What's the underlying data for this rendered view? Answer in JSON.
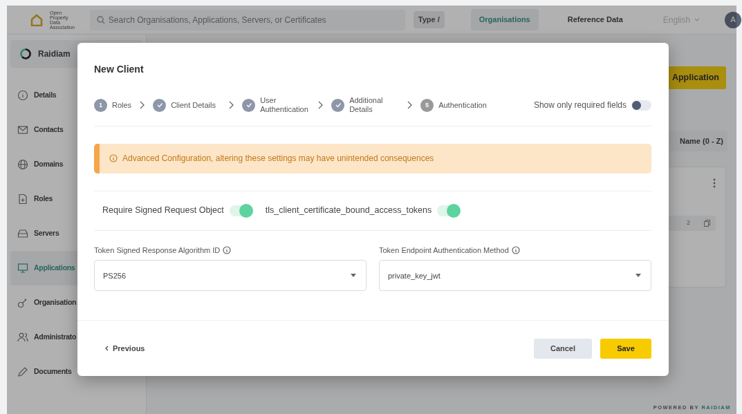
{
  "header": {
    "logo_lines": [
      "Open Property",
      "Data Association"
    ],
    "search": {
      "placeholder": "Search Organisations, Applications, Servers, or Certificates"
    },
    "shortcut": "Type /",
    "nav": [
      {
        "label": "Organisations",
        "selected": true
      },
      {
        "label": "Reference Data",
        "selected": false
      }
    ],
    "language": "English",
    "avatar": "A"
  },
  "sidebar": {
    "organisation": "Raidiam",
    "items": [
      {
        "label": "Details",
        "selected": false
      },
      {
        "label": "Contacts",
        "selected": false
      },
      {
        "label": "Domains",
        "selected": false
      },
      {
        "label": "Roles",
        "selected": false
      },
      {
        "label": "Servers",
        "selected": false
      },
      {
        "label": "Applications",
        "selected": true
      },
      {
        "label": "Organisation",
        "selected": false
      },
      {
        "label": "Administrato",
        "selected": false
      },
      {
        "label": "Documents",
        "selected": false
      }
    ]
  },
  "main": {
    "action_button": "Application",
    "sort": "Name (0 - Z)",
    "card": {
      "chip": "2"
    }
  },
  "modal": {
    "title": "New Client",
    "steps": [
      {
        "kind": "numbered",
        "marker": "1",
        "label": "Roles"
      },
      {
        "kind": "done",
        "label": "Client Details"
      },
      {
        "kind": "done",
        "label": "User Authentication"
      },
      {
        "kind": "done",
        "label": "Additional Details"
      },
      {
        "kind": "numbered",
        "marker": "5",
        "label": "Authentication"
      }
    ],
    "required_toggle": {
      "label": "Show only required fields",
      "on": false
    },
    "alert": "Advanced Configuration, altering these settings may have unintended consequences",
    "switches": [
      {
        "label": "Require Signed Request Object",
        "on": true
      },
      {
        "label": "tls_client_certificate_bound_access_tokens",
        "on": true
      }
    ],
    "selects": [
      {
        "label": "Token Signed Response Algorithm ID",
        "value": "PS256"
      },
      {
        "label": "Token Endpoint Authentication Method",
        "value": "private_key_jwt"
      }
    ],
    "previous": "Previous",
    "cancel": "Cancel",
    "save": "Save"
  },
  "footer": {
    "prefix": "POWERED BY",
    "brand": "RAIDIAM"
  }
}
